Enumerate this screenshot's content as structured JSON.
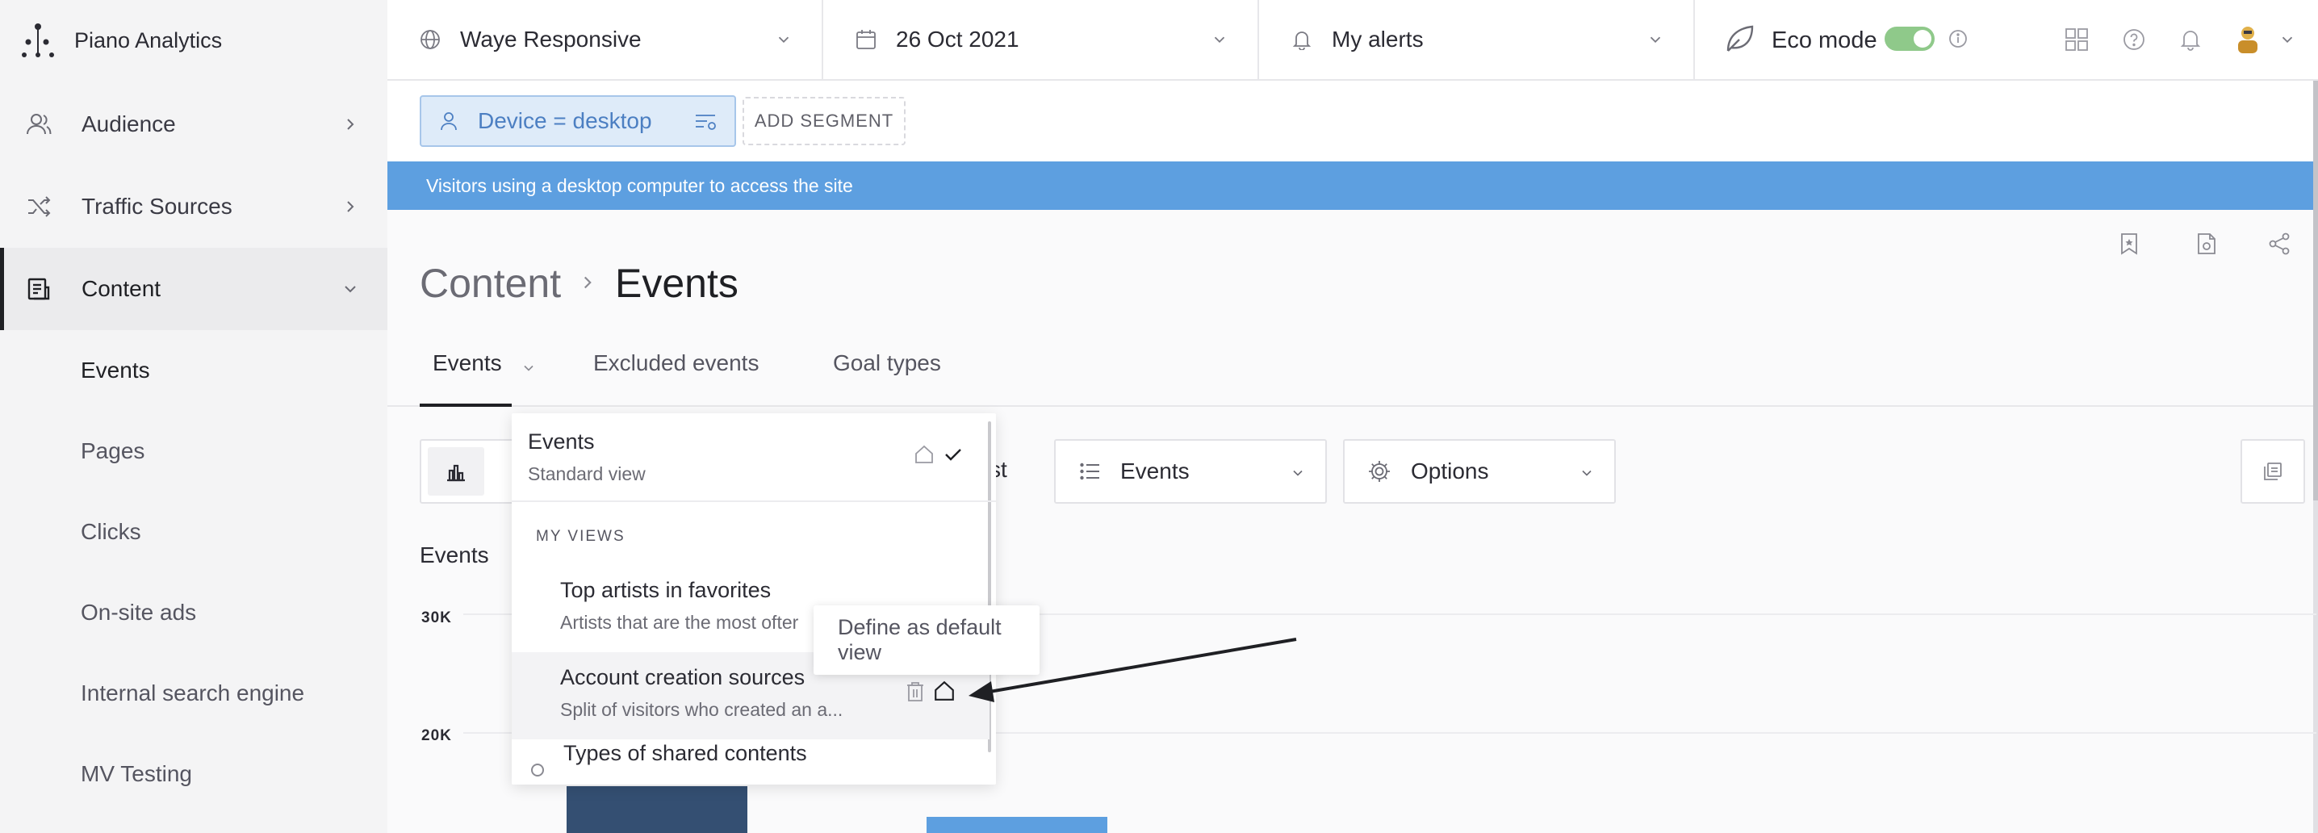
{
  "app": {
    "name": "Piano Analytics"
  },
  "sidebar": {
    "items": [
      {
        "label": "Audience"
      },
      {
        "label": "Traffic Sources"
      },
      {
        "label": "Content"
      }
    ],
    "content_subitems": [
      {
        "label": "Events"
      },
      {
        "label": "Pages"
      },
      {
        "label": "Clicks"
      },
      {
        "label": "On-site ads"
      },
      {
        "label": "Internal search engine"
      },
      {
        "label": "MV Testing"
      }
    ]
  },
  "topbar": {
    "site": "Waye Responsive",
    "date": "26 Oct 2021",
    "alerts": "My alerts",
    "eco_mode": {
      "label": "Eco mode",
      "enabled": true
    }
  },
  "segment": {
    "chip_label": "Device = desktop",
    "add_label": "ADD SEGMENT",
    "banner": "Visitors using a desktop computer to access the site"
  },
  "breadcrumb": {
    "parent": "Content",
    "current": "Events"
  },
  "tabs": [
    {
      "label": "Events"
    },
    {
      "label": "Excluded events"
    },
    {
      "label": "Goal types"
    }
  ],
  "toolbar": {
    "analyst_partial": "yst",
    "metric": "Events",
    "options": "Options"
  },
  "chart": {
    "title": "Events",
    "y_ticks": [
      "30K",
      "20K"
    ]
  },
  "views_dropdown": {
    "standard": {
      "title": "Events",
      "subtitle": "Standard view"
    },
    "section_label": "MY VIEWS",
    "items": [
      {
        "title": "Top artists in favorites",
        "subtitle": "Artists that are the most ofter"
      },
      {
        "title": "Account creation sources",
        "subtitle": "Split of visitors who created an a..."
      },
      {
        "title": "Types of shared contents"
      }
    ]
  },
  "tooltip": {
    "text": "Define as default view"
  },
  "colors": {
    "accent_blue": "#5d9fe0",
    "segment_chip_bg": "#deebf9",
    "segment_text": "#4c7fc2",
    "eco_toggle": "#8fc98a",
    "bar_dark": "#344f72",
    "bar_light": "#5d9fe0"
  }
}
